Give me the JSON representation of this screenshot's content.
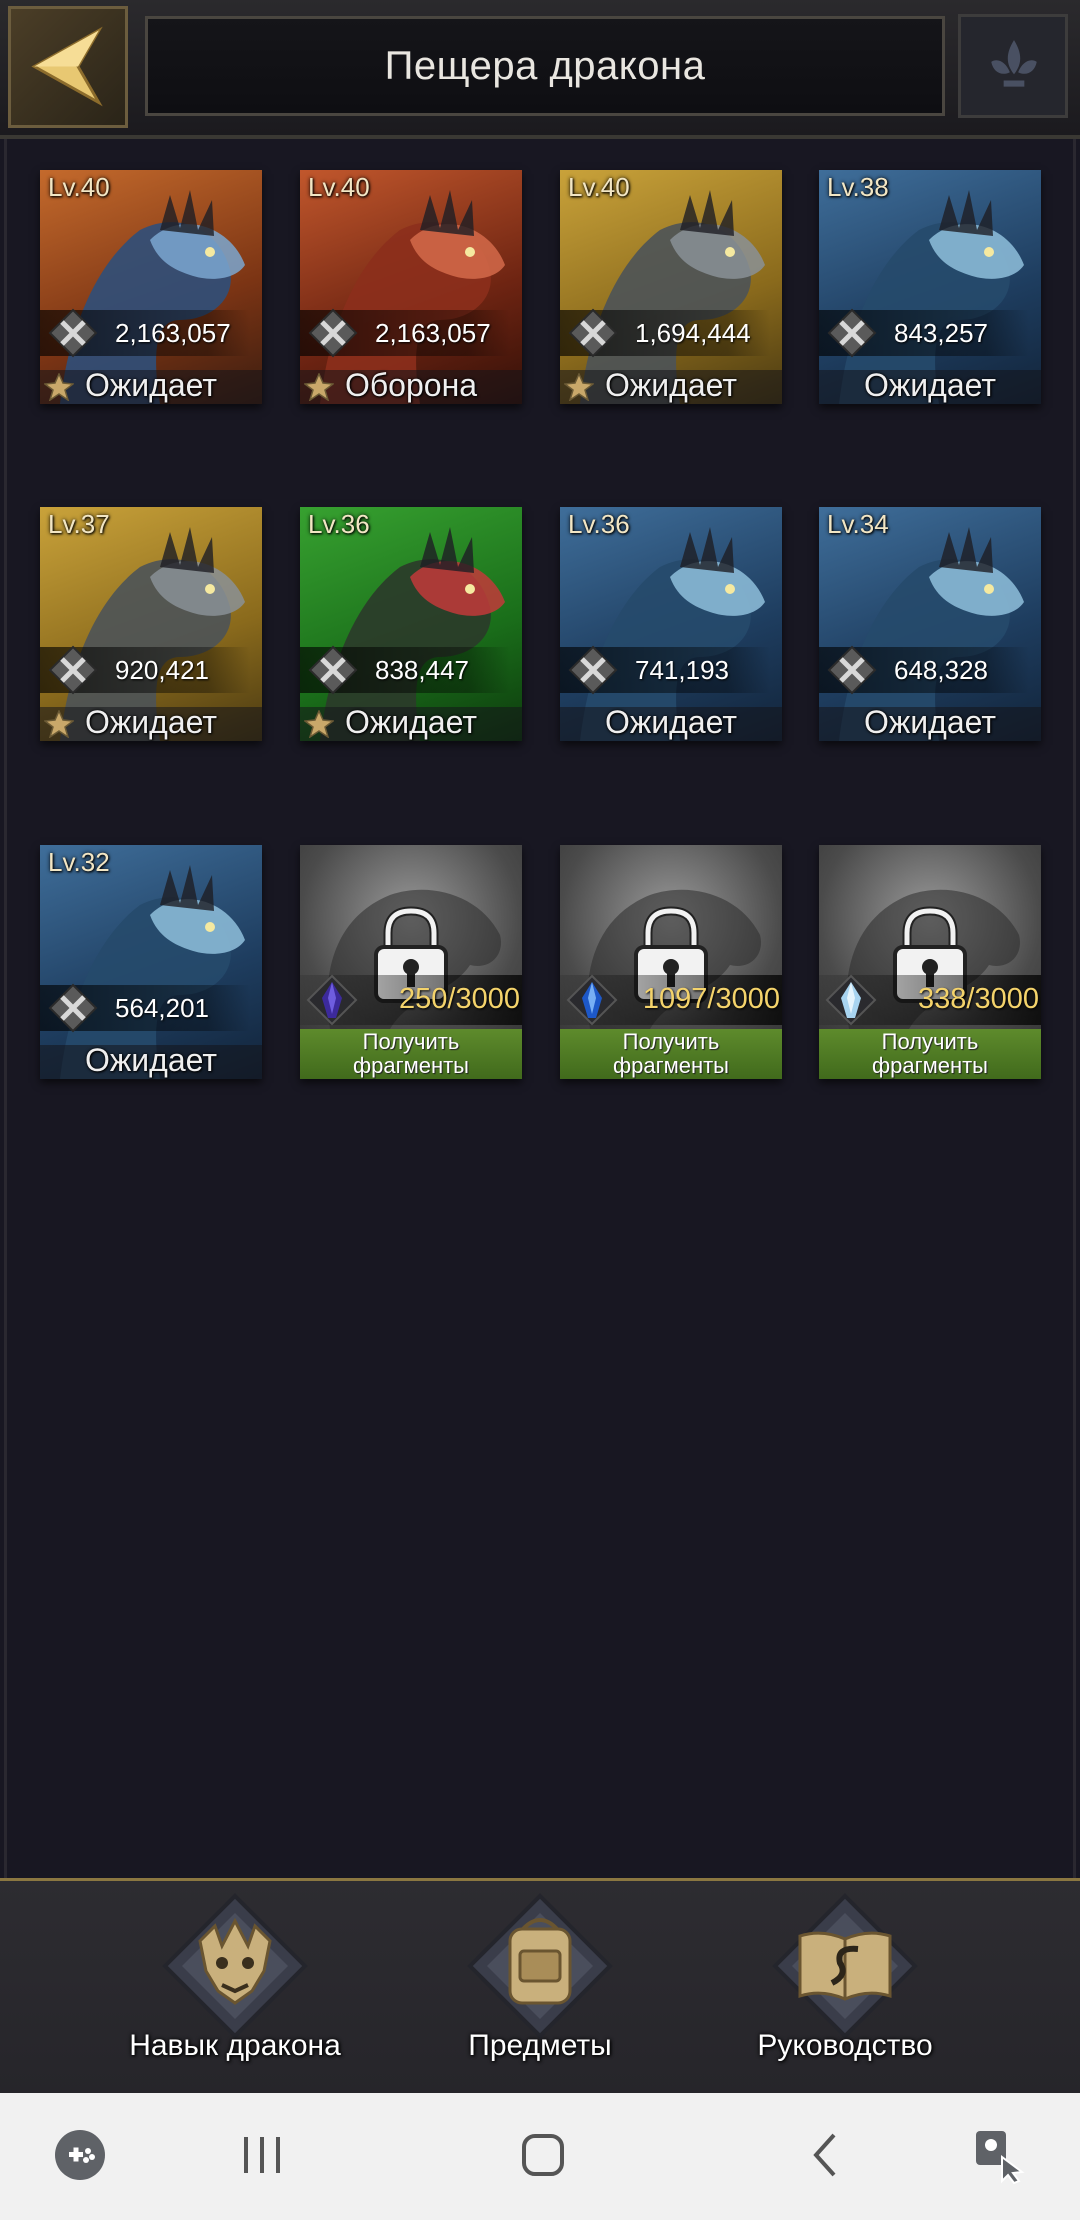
{
  "header": {
    "title": "Пещера дракона",
    "colors": {
      "accent": "#6c5d3e",
      "title_text": "#e9e6e0"
    }
  },
  "dragons": [
    {
      "level": "Lv.40",
      "power": "2,163,057",
      "status": "Ожидает",
      "starred": true,
      "theme": "orange"
    },
    {
      "level": "Lv.40",
      "power": "2,163,057",
      "status": "Оборона",
      "starred": true,
      "theme": "red"
    },
    {
      "level": "Lv.40",
      "power": "1,694,444",
      "status": "Ожидает",
      "starred": true,
      "theme": "gold"
    },
    {
      "level": "Lv.38",
      "power": "843,257",
      "status": "Ожидает",
      "starred": false,
      "theme": "blue"
    },
    {
      "level": "Lv.37",
      "power": "920,421",
      "status": "Ожидает",
      "starred": true,
      "theme": "gold"
    },
    {
      "level": "Lv.36",
      "power": "838,447",
      "status": "Ожидает",
      "starred": true,
      "theme": "green"
    },
    {
      "level": "Lv.36",
      "power": "741,193",
      "status": "Ожидает",
      "starred": false,
      "theme": "blue"
    },
    {
      "level": "Lv.34",
      "power": "648,328",
      "status": "Ожидает",
      "starred": false,
      "theme": "blue"
    },
    {
      "level": "Lv.32",
      "power": "564,201",
      "status": "Ожидает",
      "starred": false,
      "theme": "blue"
    }
  ],
  "locked_dragons": [
    {
      "fragments": "250/3000",
      "button": "Получить фрагменты",
      "crystal": "purple-crystal-icon"
    },
    {
      "fragments": "1097/3000",
      "button": "Получить фрагменты",
      "crystal": "blue-crystal-icon"
    },
    {
      "fragments": "338/3000",
      "button": "Получить фрагменты",
      "crystal": "white-crystal-icon"
    }
  ],
  "bottom_nav": [
    {
      "label": "Навык дракона",
      "icon": "dragon-skill-icon"
    },
    {
      "label": "Предметы",
      "icon": "backpack-icon"
    },
    {
      "label": "Руководство",
      "icon": "guide-book-icon"
    }
  ],
  "android_nav": [
    "game-tools-icon",
    "recent-apps-icon",
    "home-icon",
    "back-icon",
    "assistant-icon"
  ],
  "colors": {
    "fragment_text": "#f4d36b",
    "get_button": "#4f7a23",
    "background": "#17161f"
  }
}
